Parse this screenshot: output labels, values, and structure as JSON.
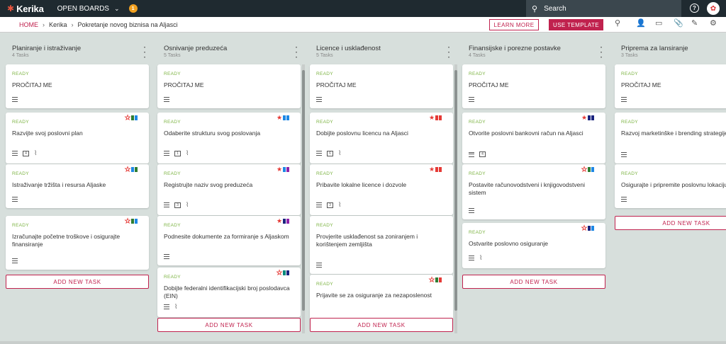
{
  "app": {
    "logo": "Kerika",
    "board_menu": "OPEN BOARDS",
    "notification_count": "1"
  },
  "search": {
    "placeholder": "Search"
  },
  "breadcrumb": {
    "home": "HOME",
    "account": "Kerika",
    "board": "Pokretanje novog biznisa na Aljasci"
  },
  "actions": {
    "learn_more": "LEARN MORE",
    "use_template": "USE TEMPLATE"
  },
  "colors": {
    "brand": "#c0224e",
    "ready": "#7cb342",
    "topbar": "#1f2a30",
    "flag_red": "#e53935",
    "flag_green": "#2e7d32",
    "flag_blue": "#1e88e5",
    "flag_navy": "#1a237e",
    "flag_purple": "#8e24aa",
    "flag_teal": "#00897b"
  },
  "add_task_label": "ADD NEW TASK",
  "columns": [
    {
      "title": "Planiranje i istraživanje",
      "count": "4 Tasks",
      "cards": [
        {
          "status": "READY",
          "title": "PROČITAJ ME"
        },
        {
          "status": "READY",
          "title": "Razvijte svoj poslovni plan",
          "checklist": "4"
        },
        {
          "status": "READY",
          "title": "Istraživanje tržišta i resursa Aljaske"
        },
        {
          "status": "READY",
          "title": "Izračunajte početne troškove i osigurajte finansiranje"
        }
      ]
    },
    {
      "title": "Osnivanje preduzeća",
      "count": "5 Tasks",
      "cards": [
        {
          "status": "READY",
          "title": "PROČITAJ ME"
        },
        {
          "status": "READY",
          "title": "Odaberite strukturu svog poslovanja",
          "checklist": "1"
        },
        {
          "status": "READY",
          "title": "Registrujte naziv svog preduzeća",
          "checklist": "3"
        },
        {
          "status": "READY",
          "title": "Podnesite dokumente za formiranje s Aljaskom"
        },
        {
          "status": "READY",
          "title": "Dobijte federalni identifikacijski broj poslodavca (EIN)"
        }
      ]
    },
    {
      "title": "Licence i usklađenost",
      "count": "5 Tasks",
      "cards": [
        {
          "status": "READY",
          "title": "PROČITAJ ME"
        },
        {
          "status": "READY",
          "title": "Dobijte poslovnu licencu na Aljasci",
          "checklist": "6"
        },
        {
          "status": "READY",
          "title": "Pribavite lokalne licence i dozvole",
          "checklist": "3"
        },
        {
          "status": "READY",
          "title": "Provjerite usklađenost sa zoniranjem i korištenjem zemljišta"
        },
        {
          "status": "READY",
          "title": "Prijavite se za osiguranje za nezaposlenost"
        }
      ]
    },
    {
      "title": "Finansijske i porezne postavke",
      "count": "4 Tasks",
      "cards": [
        {
          "status": "READY",
          "title": "PROČITAJ ME"
        },
        {
          "status": "READY",
          "title": "Otvorite poslovni bankovni račun na Aljasci",
          "checklist": "4"
        },
        {
          "status": "READY",
          "title": "Postavite računovodstveni i knjigovodstveni sistem"
        },
        {
          "status": "READY",
          "title": "Ostvarite poslovno osiguranje"
        }
      ]
    },
    {
      "title": "Priprema za lansiranje",
      "count": "3 Tasks",
      "cards": [
        {
          "status": "READY",
          "title": "PROČITAJ ME"
        },
        {
          "status": "READY",
          "title": "Razvoj marketinške i brending strategije"
        },
        {
          "status": "READY",
          "title": "Osigurajte i pripremite poslovnu lokaciju"
        }
      ]
    }
  ]
}
